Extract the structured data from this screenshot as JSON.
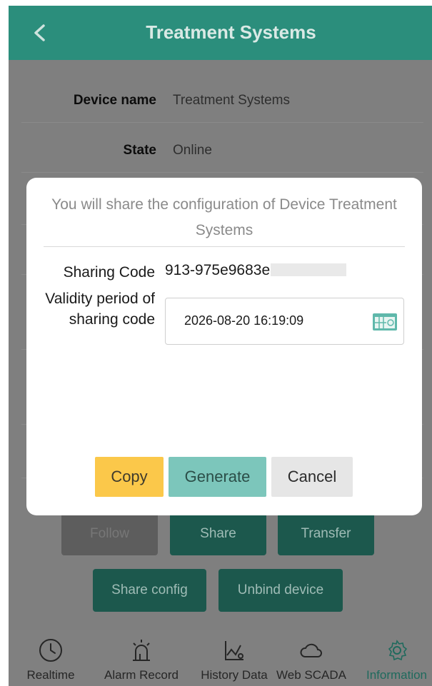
{
  "header": {
    "title": "Treatment Systems",
    "back_icon": "chevron-left-icon"
  },
  "device_info": {
    "device_name_label": "Device name",
    "device_name_value": "Treatment Systems",
    "state_label": "State",
    "state_value": "Online"
  },
  "background_buttons": {
    "follow": "Follow",
    "share": "Share",
    "transfer": "Transfer",
    "share_config": "Share config",
    "unbind_device": "Unbind device"
  },
  "tabs": [
    {
      "label": "Realtime",
      "icon": "clock-icon"
    },
    {
      "label": "Alarm Record",
      "icon": "alarm-siren-icon"
    },
    {
      "label": "History Data",
      "icon": "chart-icon"
    },
    {
      "label": "Web SCADA",
      "icon": "cloud-icon"
    },
    {
      "label": "Information",
      "icon": "gear-icon",
      "active": true
    }
  ],
  "dialog": {
    "message": "You will share the configuration of Device Treatment Systems",
    "sharing_code_label": "Sharing Code",
    "sharing_code_value": "913-975e9683e",
    "validity_label": "Validity period of sharing code",
    "validity_value": "2026-08-20 16:19:09",
    "calendar_icon": "calendar-icon",
    "copy_label": "Copy",
    "generate_label": "Generate",
    "cancel_label": "Cancel"
  },
  "colors": {
    "header": "#2b8e7c",
    "copy": "#fbc84a",
    "generate": "#7cc6bb",
    "cancel": "#e6e6e6"
  }
}
